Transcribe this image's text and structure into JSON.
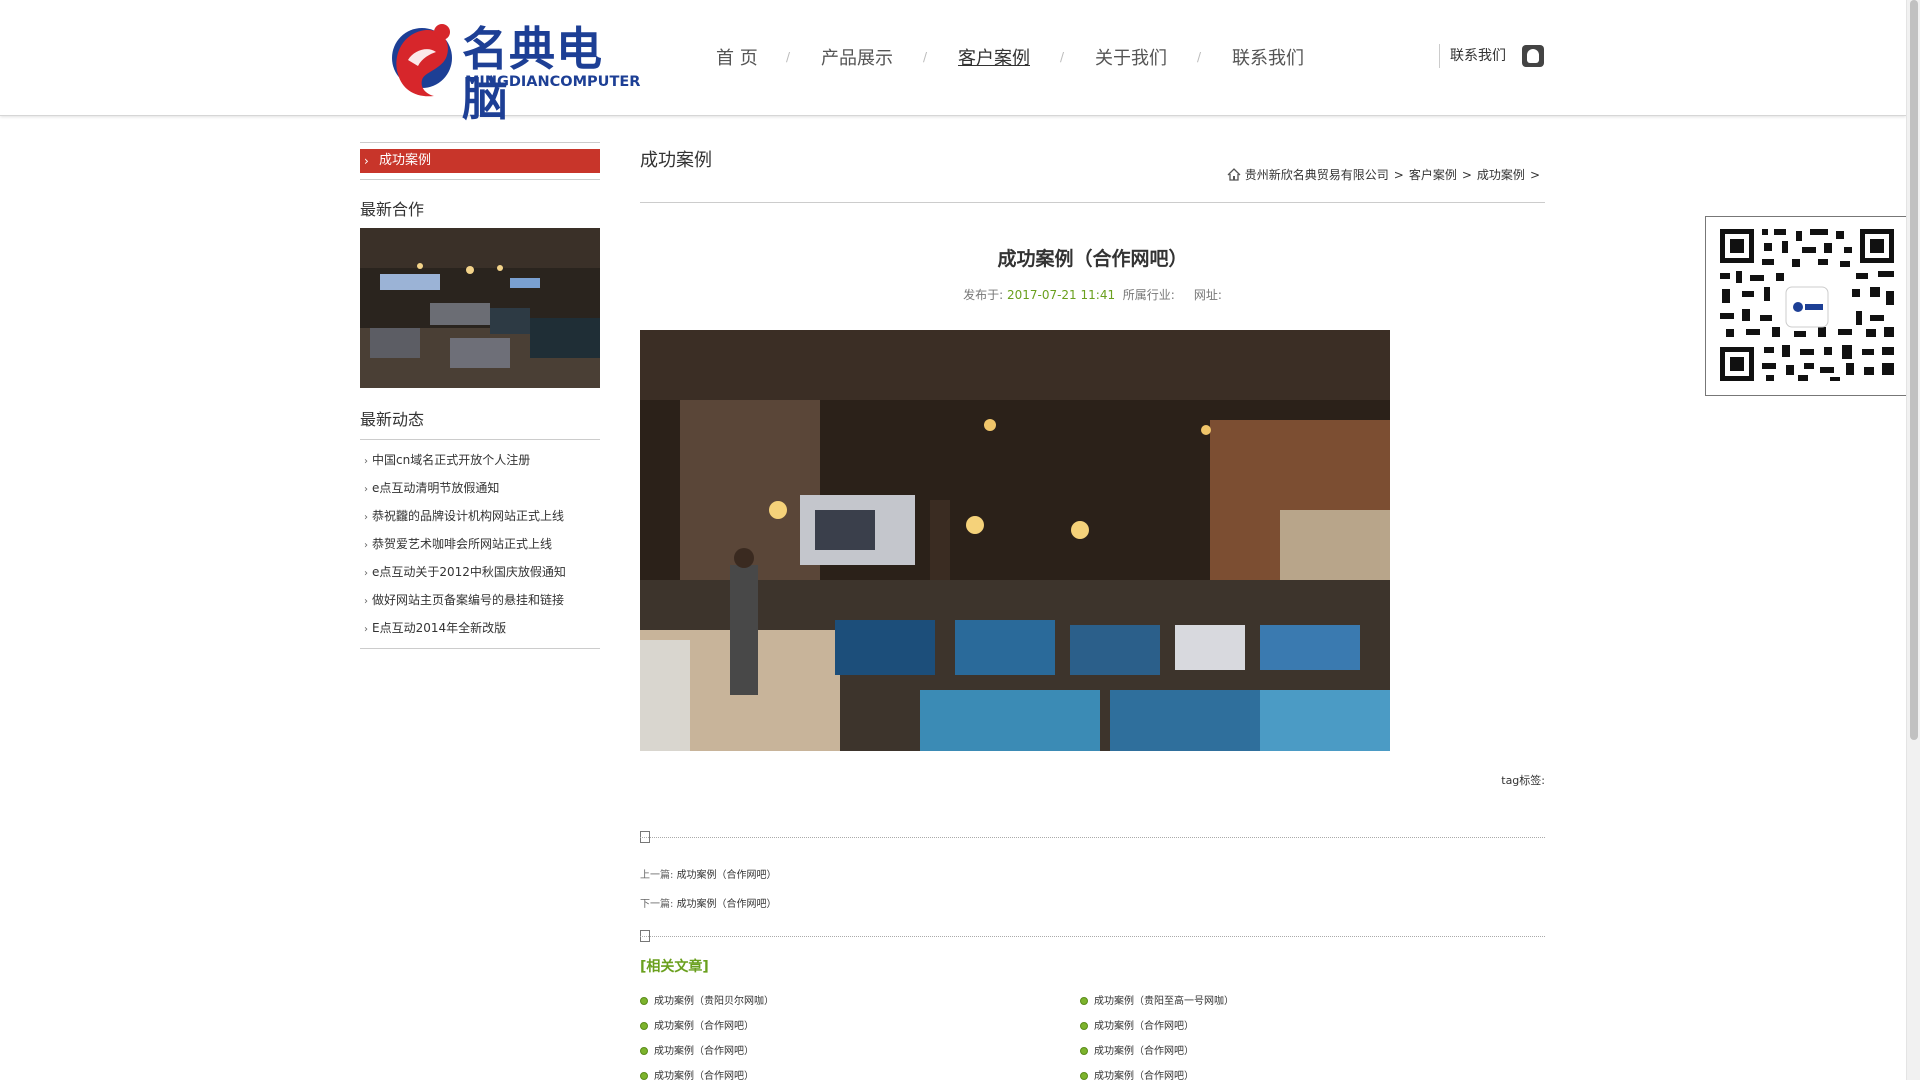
{
  "header": {
    "logo_cn": "名典电脑",
    "logo_en": "MINGDIANCOMPUTER",
    "nav": [
      {
        "label": "首 页"
      },
      {
        "label": "产品展示"
      },
      {
        "label": "客户案例",
        "active": true
      },
      {
        "label": "关于我们"
      },
      {
        "label": "联系我们"
      }
    ],
    "nav_separator": "/",
    "contact_label": "联系我们",
    "qq_icon": "qq-icon"
  },
  "sidebar": {
    "category_active": "成功案例",
    "latest_coop_title": "最新合作",
    "latest_news_title": "最新动态",
    "news": [
      "中国cn域名正式开放个人注册",
      "e点互动清明节放假通知",
      "恭祝龖的品牌设计机构网站正式上线",
      "恭贺爱艺术咖啡会所网站正式上线",
      "e点互动关于2012中秋国庆放假通知",
      "做好网站主页备案编号的悬挂和链接",
      "E点互动2014年全新改版"
    ]
  },
  "main": {
    "page_title": "成功案例",
    "breadcrumb": [
      "贵州新欣名典贸易有限公司",
      "客户案例",
      "成功案例"
    ],
    "breadcrumb_sep": ">",
    "article_title": "成功案例（合作网吧）",
    "meta_published_label": "发布于:",
    "meta_date": "2017-07-21 11:41",
    "meta_industry_label": "所属行业:",
    "meta_url_label": "网址:",
    "tag_label": "tag标签:",
    "prev_label": "上一篇:",
    "prev_title": "成功案例（合作网吧）",
    "next_label": "下一篇:",
    "next_title": "成功案例（合作网吧）",
    "related_title": "[相关文章]",
    "related": [
      "成功案例（贵阳贝尔网咖）",
      "成功案例（贵阳至高一号网咖）",
      "成功案例（合作网吧）",
      "成功案例（合作网吧）",
      "成功案例（合作网吧）",
      "成功案例（合作网吧）",
      "成功案例（合作网吧）",
      "成功案例（合作网吧）"
    ]
  },
  "colors": {
    "accent_red": "#c8352a",
    "brand_blue": "#1d3f95",
    "date_green": "#6aa01e"
  }
}
